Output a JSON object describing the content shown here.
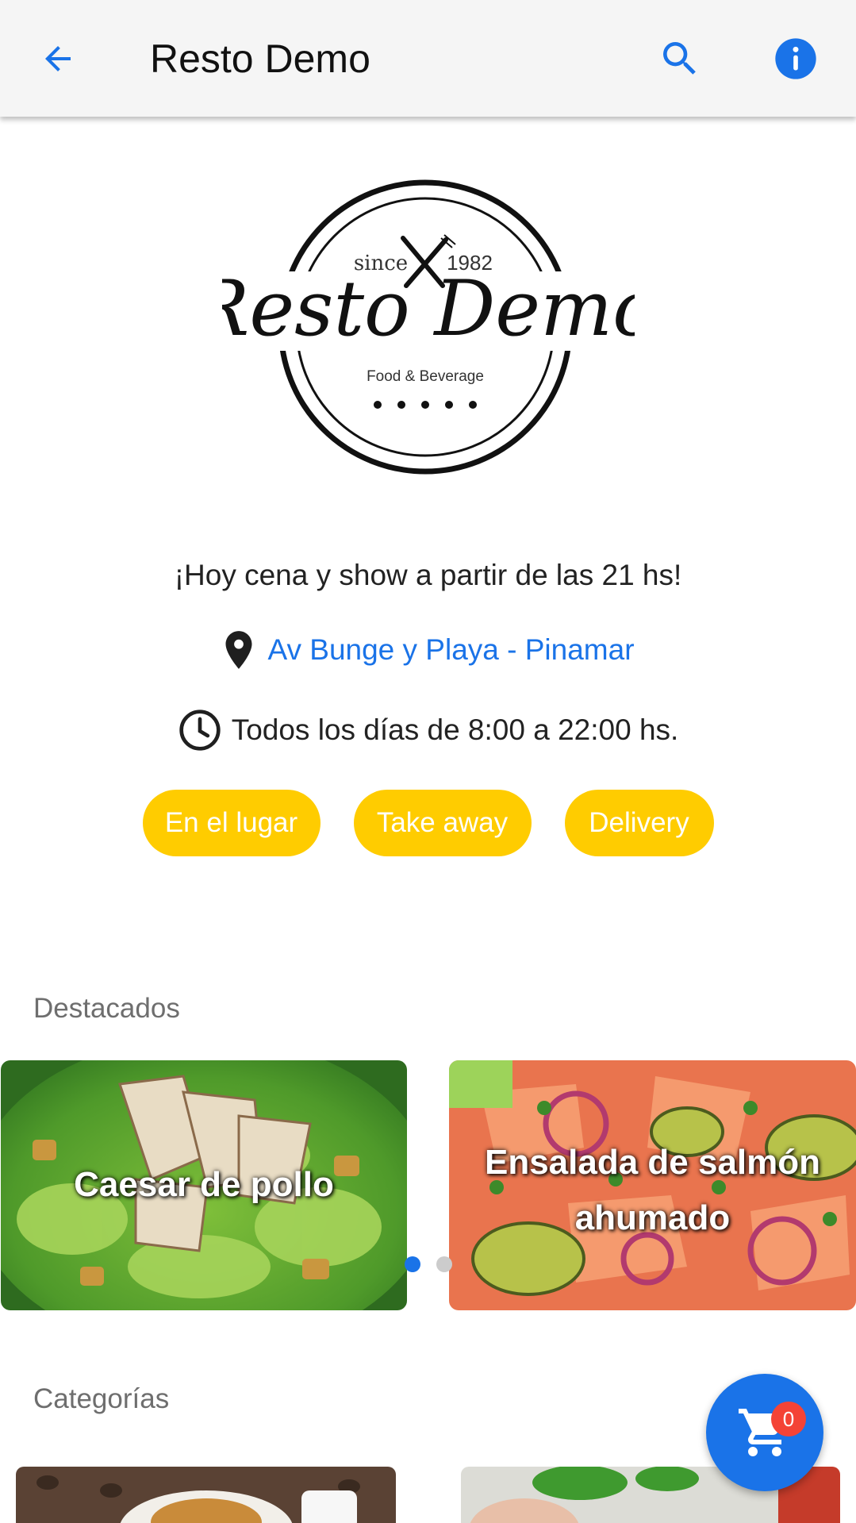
{
  "appbar": {
    "title": "Resto Demo",
    "back_icon": "arrow-left-icon",
    "search_icon": "search-icon",
    "info_icon": "info-icon"
  },
  "logo": {
    "since": "since",
    "year": "1982",
    "name": "Resto Demo",
    "subtitle": "Food & Beverage"
  },
  "restaurant": {
    "tagline": "¡Hoy cena y show a partir de las 21 hs!",
    "address": "Av Bunge y Playa - Pinamar",
    "hours": "Todos los días de 8:00 a 22:00 hs."
  },
  "service_options": [
    "En el lugar",
    "Take away",
    "Delivery"
  ],
  "featured": {
    "title": "Destacados",
    "items": [
      {
        "label": "Caesar de pollo"
      },
      {
        "label": "Ensalada de salmón ahumado"
      }
    ],
    "active_page": 1,
    "page_count": 2
  },
  "categories": {
    "title": "Categorías"
  },
  "cart": {
    "count": "0",
    "icon": "cart-icon"
  },
  "colors": {
    "accent": "#1a73e8",
    "chip": "#ffcc00",
    "badge": "#f44336"
  }
}
